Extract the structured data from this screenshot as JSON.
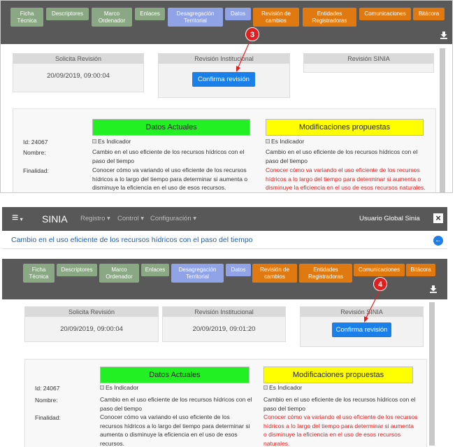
{
  "tabs": [
    {
      "label": "Ficha\nTécnica",
      "style": "tg"
    },
    {
      "label": "Descriptores",
      "style": "tg"
    },
    {
      "label": "Marco\nOrdenador",
      "style": "tg"
    },
    {
      "label": "Enlaces",
      "style": "tg"
    },
    {
      "label": "Desagregación\nTerritorial",
      "style": "tb"
    },
    {
      "label": "Datos",
      "style": "tb"
    },
    {
      "label": "Revisión de\ncambios",
      "style": "to"
    },
    {
      "label": "Entidades\nRegistradoras",
      "style": "to"
    },
    {
      "label": "Comunicaciones",
      "style": "to"
    },
    {
      "label": "Bitácora",
      "style": "to"
    }
  ],
  "download_icon": "download-icon",
  "top": {
    "badge": "3",
    "rev": [
      {
        "title": "Solicita Revisión",
        "value": "20/09/2019, 09:00:04"
      },
      {
        "title": "Revisión Institucional",
        "value": ""
      },
      {
        "title": "Revisión SINIA",
        "value": ""
      }
    ],
    "button": "Confirma revisión"
  },
  "bottom": {
    "badge": "4",
    "rev": [
      {
        "title": "Solicita Revisión",
        "value": "20/09/2019, 09:00:04"
      },
      {
        "title": "Revisión Institucional",
        "value": "20/09/2019, 09:01:20"
      },
      {
        "title": "Revisión SINIA",
        "value": ""
      }
    ],
    "button": "Confirma revisión"
  },
  "nav": {
    "brand": "SINIA",
    "menu_icon": "≡",
    "items": [
      "Registro ▾",
      "Control ▾",
      "Configuración ▾"
    ],
    "user": "Usuario Global Sinia",
    "close": "×"
  },
  "page_title": "Cambio en el uso eficiente de los recursos hídricos con el paso del tiempo",
  "back_icon": "back-arrow-icon",
  "data": {
    "current_header": "Datos Actuales",
    "proposed_header": "Modificaciones propuestas",
    "id_label": "Id: 24067",
    "checkbox": "Es Indicador",
    "nombre_label": "Nombre:",
    "finalidad_label": "Finalidad:",
    "nombre_current": "Cambio en el uso eficiente de los recursos hídricos con el paso del tiempo",
    "nombre_proposed": "Cambio en el uso eficiente de los recursos hídricos con el paso del tiempo",
    "finalidad_current": "Conocer cómo va variando el uso eficiente de los recursos hídricos a lo largo del tiempo para determinar si aumenta o disminuye la eficiencia en el uso de esos recursos.",
    "finalidad_proposed": "Conocer cómo va variando el uso eficiente de los recursos hídricos a lo largo del tiempo para determinar si aumenta o disminuye la eficiencia en el uso de esos recursos naturales."
  }
}
